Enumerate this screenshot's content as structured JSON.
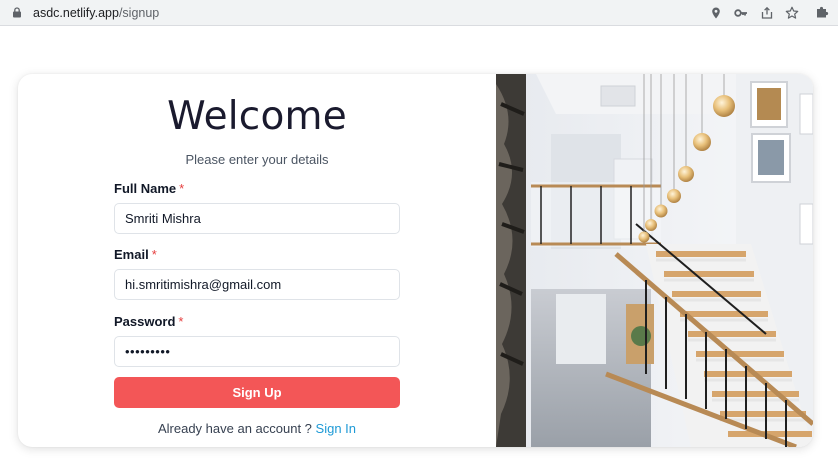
{
  "browser": {
    "url_domain": "asdc.netlify.app",
    "url_path": "/signup",
    "icons": [
      "lock-icon",
      "location-pin-icon",
      "key-icon",
      "share-icon",
      "star-icon",
      "extension-puzzle-icon"
    ]
  },
  "form": {
    "title": "Welcome",
    "subtitle": "Please enter your details",
    "full_name": {
      "label": "Full Name",
      "required_mark": "*",
      "value": "Smriti Mishra"
    },
    "email": {
      "label": "Email",
      "required_mark": "*",
      "value": "hi.smritimishra@gmail.com"
    },
    "password": {
      "label": "Password",
      "required_mark": "*",
      "value": "•••••••••"
    },
    "submit_label": "Sign Up",
    "signin_prompt": "Already have an account ?",
    "signin_link": "Sign In"
  },
  "colors": {
    "accent_button": "#f35657",
    "link": "#1e9ad6",
    "required": "#e53e3e"
  }
}
